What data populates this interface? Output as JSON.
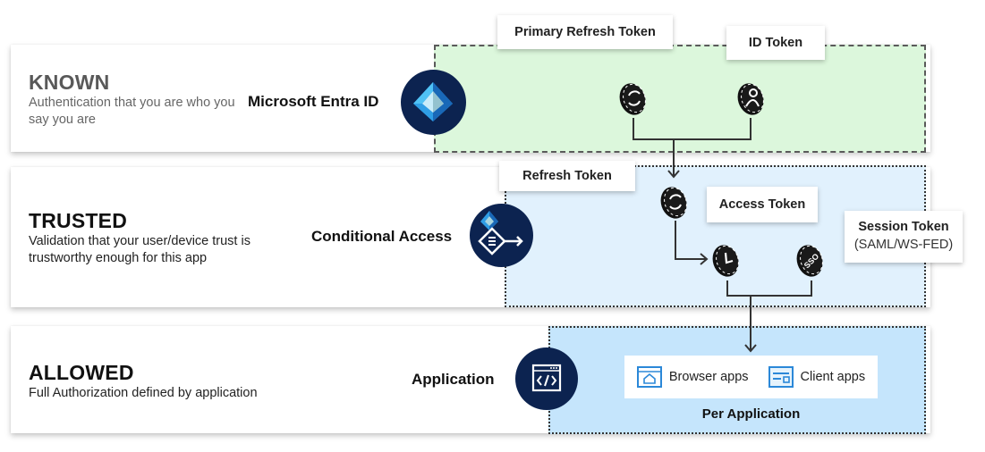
{
  "tiers": {
    "known": {
      "title": "KNOWN",
      "description": "Authentication that you are who you say you are",
      "service": "Microsoft Entra ID",
      "service_icon": "entra-id-pyramid-icon",
      "zone_color": "#dcf7dc"
    },
    "trusted": {
      "title": "TRUSTED",
      "description": "Validation that your user/device trust is trustworthy enough for this app",
      "service": "Conditional Access",
      "service_icon": "conditional-access-icon",
      "zone_color": "#e1f1fd"
    },
    "allowed": {
      "title": "ALLOWED",
      "description": "Full Authorization defined by application",
      "service": "Application",
      "service_icon": "application-code-icon",
      "zone_color": "#c5e5fc"
    }
  },
  "tokens": {
    "primary_refresh": {
      "label": "Primary Refresh Token",
      "icon": "refresh-coin-icon"
    },
    "id": {
      "label": "ID Token",
      "icon": "user-coin-icon"
    },
    "refresh": {
      "label": "Refresh Token",
      "icon": "refresh-coin-icon"
    },
    "access": {
      "label": "Access Token",
      "icon": "clock-coin-icon"
    },
    "session": {
      "label": "Session Token",
      "sublabel": "(SAML/WS-FED)",
      "icon": "sso-coin-icon"
    }
  },
  "apps": {
    "browser": {
      "label": "Browser apps",
      "icon": "browser-app-icon"
    },
    "client": {
      "label": "Client apps",
      "icon": "client-app-icon"
    },
    "caption": "Per Application"
  },
  "colors": {
    "badge_navy": "#0c2350",
    "accent_blue": "#2b88d8"
  }
}
